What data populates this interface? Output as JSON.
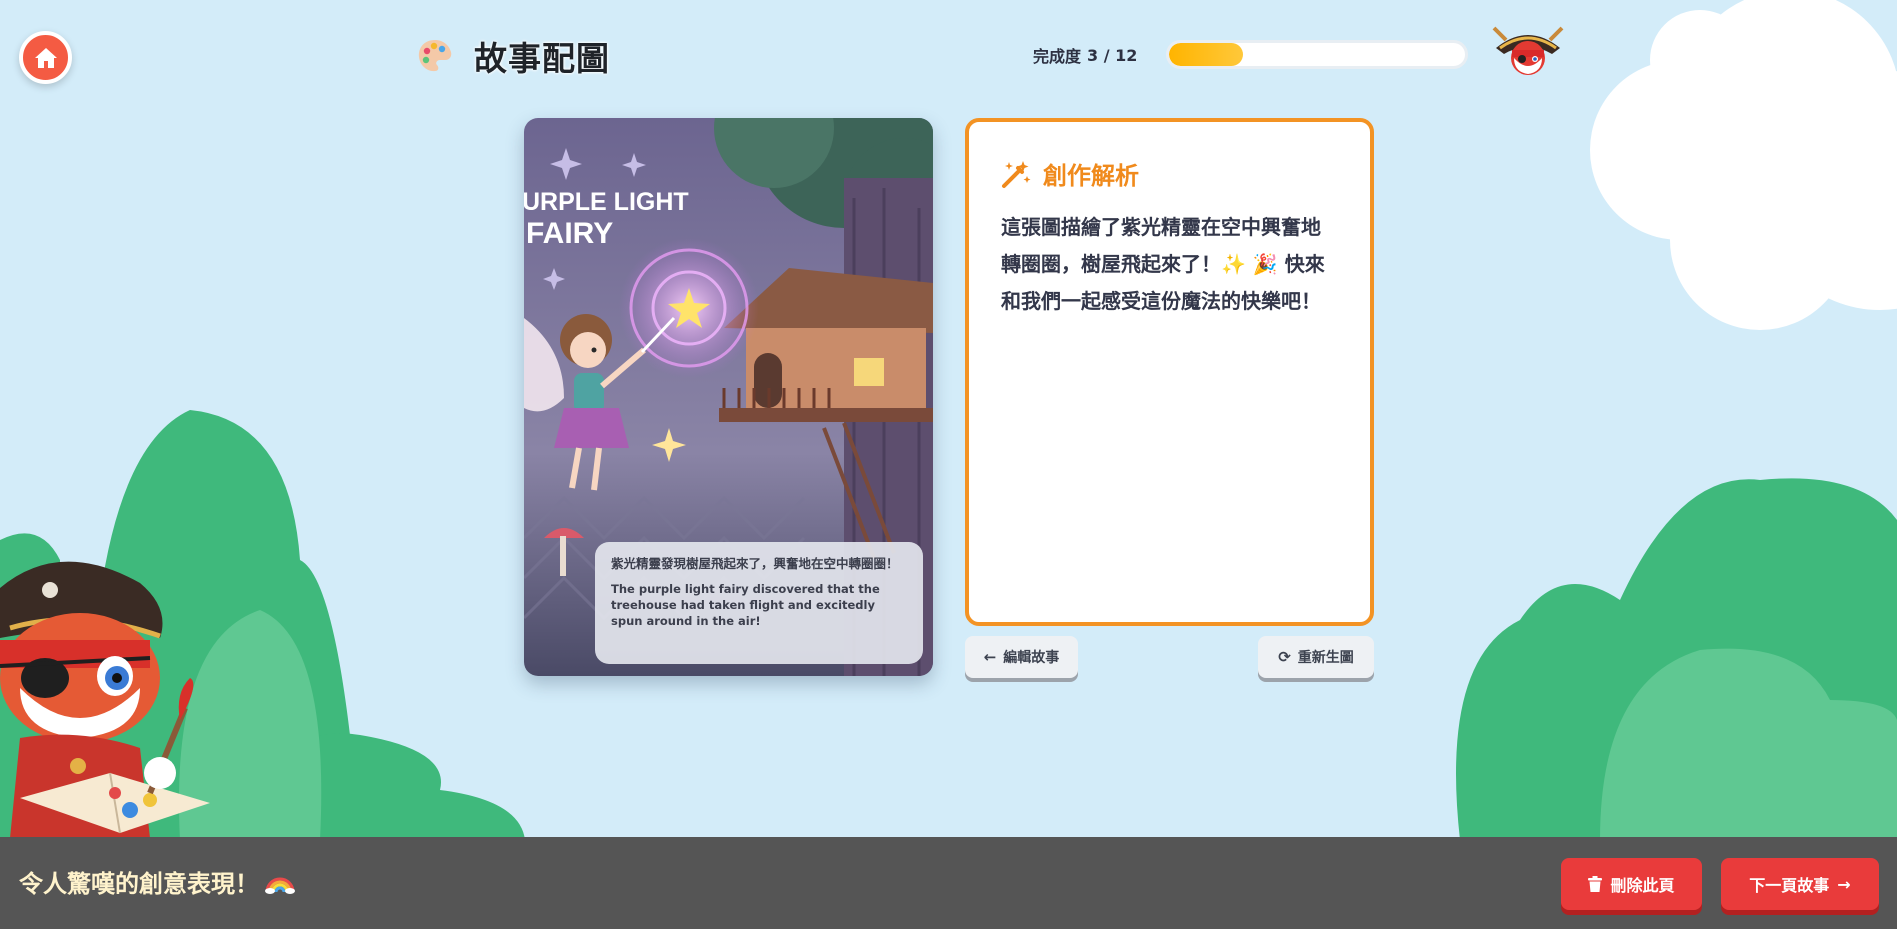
{
  "header": {
    "title": "故事配圖",
    "progress_label": "完成度",
    "progress_count": "3 / 12",
    "progress_fraction": 0.25,
    "icons": {
      "home": "home-icon",
      "palette": "palette-icon",
      "mascot": "pirate-cat-mascot-icon"
    }
  },
  "story_card": {
    "image_title_line1": "URPLE LIGHT",
    "image_title_line2": "FAIRY",
    "caption_zh": "紫光精靈發現樹屋飛起來了，興奮地在空中轉圈圈！",
    "caption_en": "The purple light fairy discovered that the treehouse had taken flight and excitedly spun around in the air!"
  },
  "analysis": {
    "title": "創作解析",
    "text": "這張圖描繪了紫光精靈在空中興奮地轉圈圈，樹屋飛起來了！✨ 🎉 快來和我們一起感受這份魔法的快樂吧！"
  },
  "actions": {
    "edit_label": "編輯故事",
    "regenerate_label": "重新生圖",
    "delete_label": "刪除此頁",
    "next_label": "下一頁故事"
  },
  "footer": {
    "message": "令人驚嘆的創意表現！"
  },
  "colors": {
    "background": "#d3ecf9",
    "accent_orange": "#f39324",
    "danger_red": "#e93b3b",
    "footer_bg": "#555555",
    "bush_green": "#3fb97c"
  }
}
